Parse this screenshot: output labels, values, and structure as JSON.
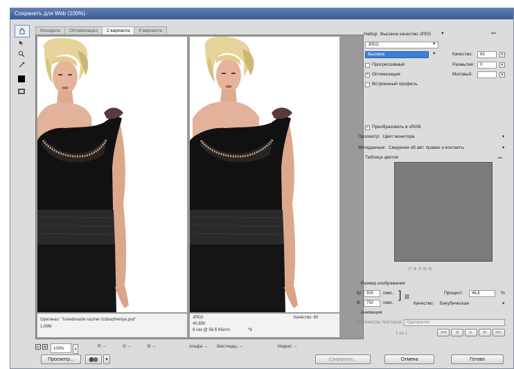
{
  "window": {
    "title": "Сохранить для Web (100%)"
  },
  "tabs": [
    "Исходное",
    "Оптимизация",
    "2 варианта",
    "4 варианта"
  ],
  "active_tab": 2,
  "left_info": {
    "line1": "Оригинал: \"Issledovanie razmer izobrazheniya.psd\"",
    "line2": "1,09M"
  },
  "right_info": {
    "format": "JPEG",
    "size": "40,85K",
    "time": "8 сек @ 56.6 Кбит/с",
    "time_extra": "*8",
    "quality": "Качество: 60"
  },
  "bottom": {
    "zoom": "100%",
    "r": "R: --",
    "g": "G: --",
    "b": "B: --",
    "alpha": "Альфа: --",
    "hex": "Шестнадц.: --",
    "index": "Индекс: --",
    "preview_btn": "Просмотр...",
    "save_btn": "Сохранить...",
    "cancel_btn": "Отмена",
    "done_btn": "Готово"
  },
  "panel": {
    "preset_label": "Набор:",
    "preset_value": "Высокое качество JPEG",
    "format_value": "JPEG",
    "quality_preset": "Высокое",
    "quality_label": "Качество:",
    "quality_value": "60",
    "progressive_label": "Прогрессивный",
    "blur_label": "Размытие:",
    "blur_value": "0",
    "optimized_label": "Оптимизация",
    "matte_label": "Матовый:",
    "embed_profile_label": "Встроенный профиль",
    "convert_srgb_label": "Преобразовать в sRGB",
    "preview_label": "Просмотр:",
    "preview_value": "Цвет монитора",
    "metadata_label": "Метаданные:",
    "metadata_value": "Сведения об авт. правах и контакты",
    "color_table_label": "Таблица цветов",
    "image_size_label": "Размер изображения",
    "width_label": "Ш:",
    "width_value": "500",
    "height_label": "В:",
    "height_value": "750",
    "unit_px": "пикс.",
    "percent_label": "Процент:",
    "percent_value": "46,8",
    "percent_unit": "%",
    "resample_label": "Качество:",
    "resample_value": "Бикубическая",
    "animation_label": "Анимация",
    "loop_label": "Параметры повторов:",
    "loop_value": "Однократно",
    "frame_counter": "1 из 1"
  }
}
